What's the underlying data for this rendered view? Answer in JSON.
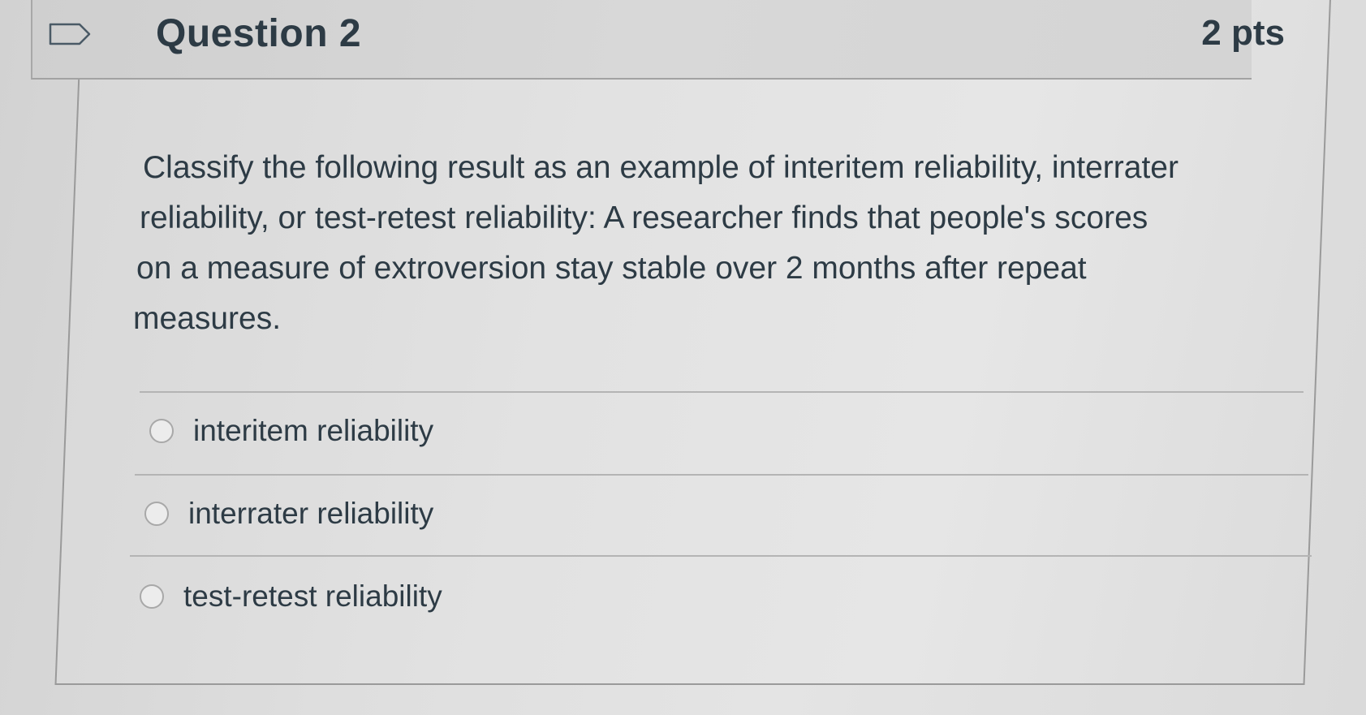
{
  "question": {
    "title": "Question 2",
    "points": "2 pts",
    "text_lines": [
      "Classify the following result as an example of interitem reliability, interrater",
      "reliability, or test-retest reliability: A researcher finds that people's scores",
      "on a measure of extroversion stay stable over 2 months after repeat",
      "measures."
    ]
  },
  "answers": [
    {
      "label": "interitem reliability",
      "selected": false
    },
    {
      "label": "interrater reliability",
      "selected": false
    },
    {
      "label": "test-retest reliability",
      "selected": false
    }
  ],
  "icons": {
    "flag": "flag-question-icon",
    "radio": "radio-unselected-icon"
  },
  "colors": {
    "text": "#2d3b45",
    "header_bg": "#d4d4d4",
    "border": "#9a9a9a"
  }
}
